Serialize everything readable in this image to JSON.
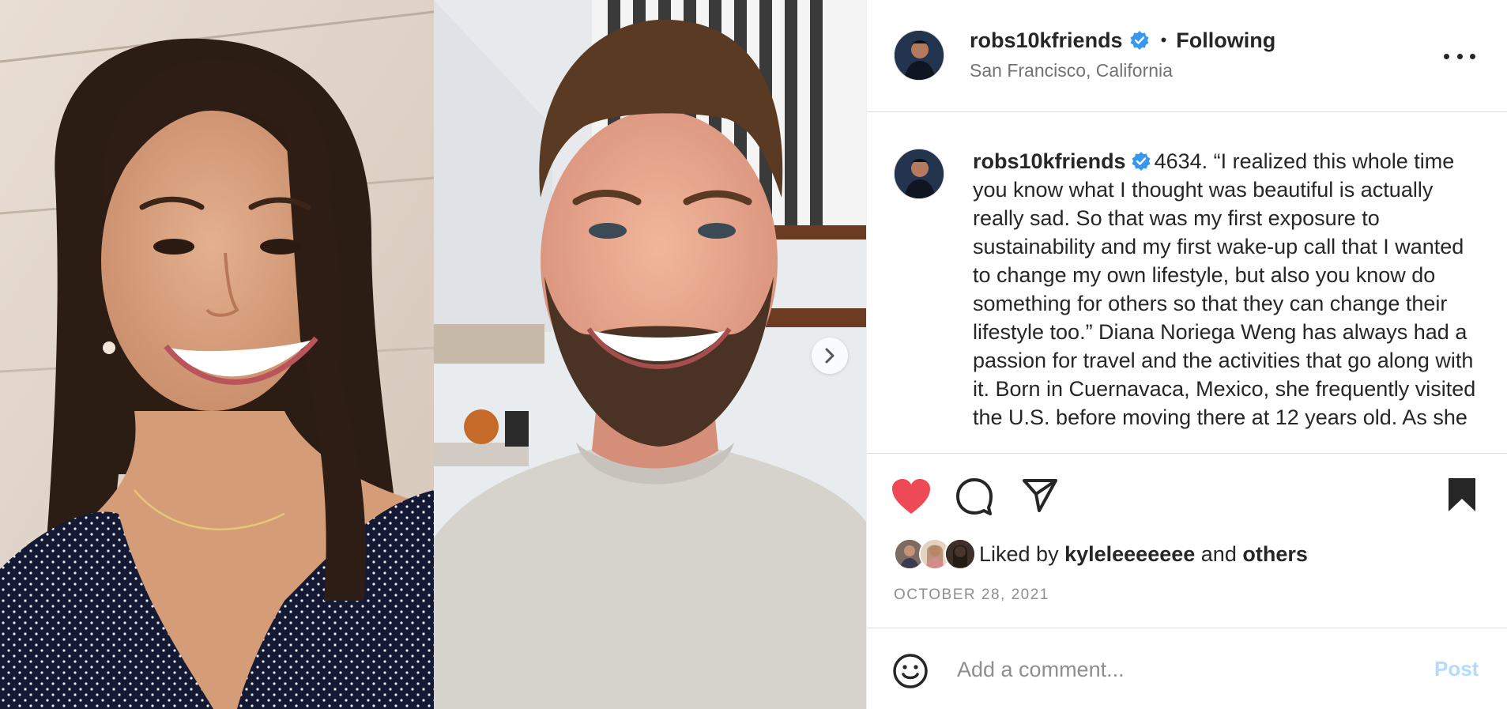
{
  "post": {
    "username": "robs10kfriends",
    "follow_state": "Following",
    "separator": "•",
    "location": "San Francisco, California",
    "more_label": "...",
    "caption": "4634. “I realized this whole time you know what I thought was beautiful is actually really sad. So that was my first exposure to sustainability and my first wake-up call that I wanted to change my own lifestyle, but also you know do something for others so that they can change their lifestyle too.” Diana Noriega Weng has always had a passion for travel and the activities that go along with it. Born in Cuernavaca, Mexico, she frequently visited the U.S. before moving there at 12 years old. As she",
    "liked_by_prefix": "Liked by",
    "liked_by_user": "kyleleeeeeee",
    "liked_by_and": "and",
    "liked_by_others": "others",
    "date": "OCTOBER 28, 2021"
  },
  "comment": {
    "placeholder": "Add a comment...",
    "post_label": "Post"
  },
  "colors": {
    "like_red": "#ed4956",
    "verified_blue": "#3897f0",
    "post_disabled": "#b3dbff",
    "secondary_text": "#737373"
  },
  "icons": [
    "verified-badge-icon",
    "more-options-icon",
    "heart-icon",
    "comment-icon",
    "share-icon",
    "bookmark-icon",
    "emoji-icon",
    "chevron-right-icon"
  ]
}
